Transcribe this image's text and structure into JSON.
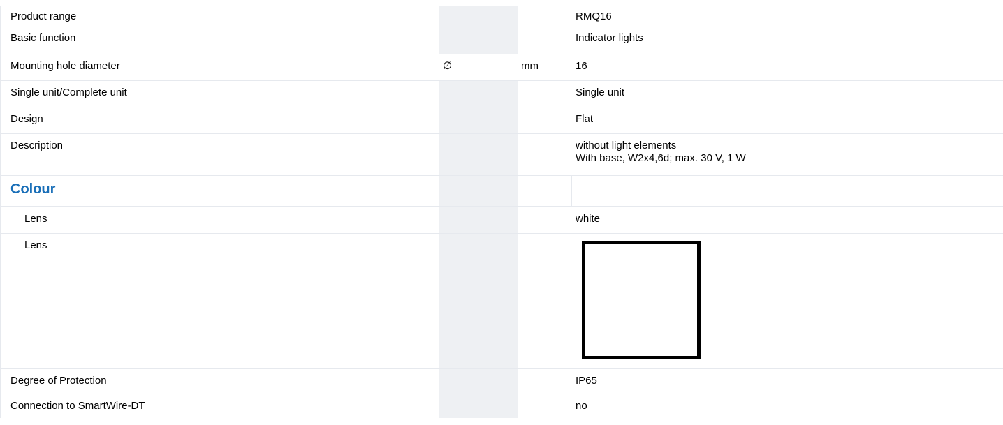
{
  "product_range": {
    "label": "Product range",
    "value": "RMQ16"
  },
  "basic_function": {
    "label": "Basic function",
    "value": "Indicator lights"
  },
  "mounting_hole": {
    "label": "Mounting hole diameter",
    "symbol": "∅",
    "unit": "mm",
    "value": "16"
  },
  "single_unit": {
    "label": "Single unit/Complete unit",
    "value": "Single unit"
  },
  "design": {
    "label": "Design",
    "value": "Flat"
  },
  "description": {
    "label": "Description",
    "value_line1": "without light elements",
    "value_line2": "With base, W2x4,6d; max. 30 V, 1 W"
  },
  "colour_section": {
    "title": "Colour"
  },
  "lens_text": {
    "label": "Lens",
    "value": "white"
  },
  "lens_swatch": {
    "label": "Lens",
    "swatch_color": "#ffffff",
    "swatch_border": "#000000"
  },
  "degree_protection": {
    "label": "Degree of Protection",
    "value": "IP65"
  },
  "smartwire": {
    "label": "Connection to SmartWire-DT",
    "value": "no"
  },
  "colors": {
    "heading_blue": "#1a6fb8",
    "shade": "#eef0f3",
    "divider": "#e6e9ee"
  }
}
